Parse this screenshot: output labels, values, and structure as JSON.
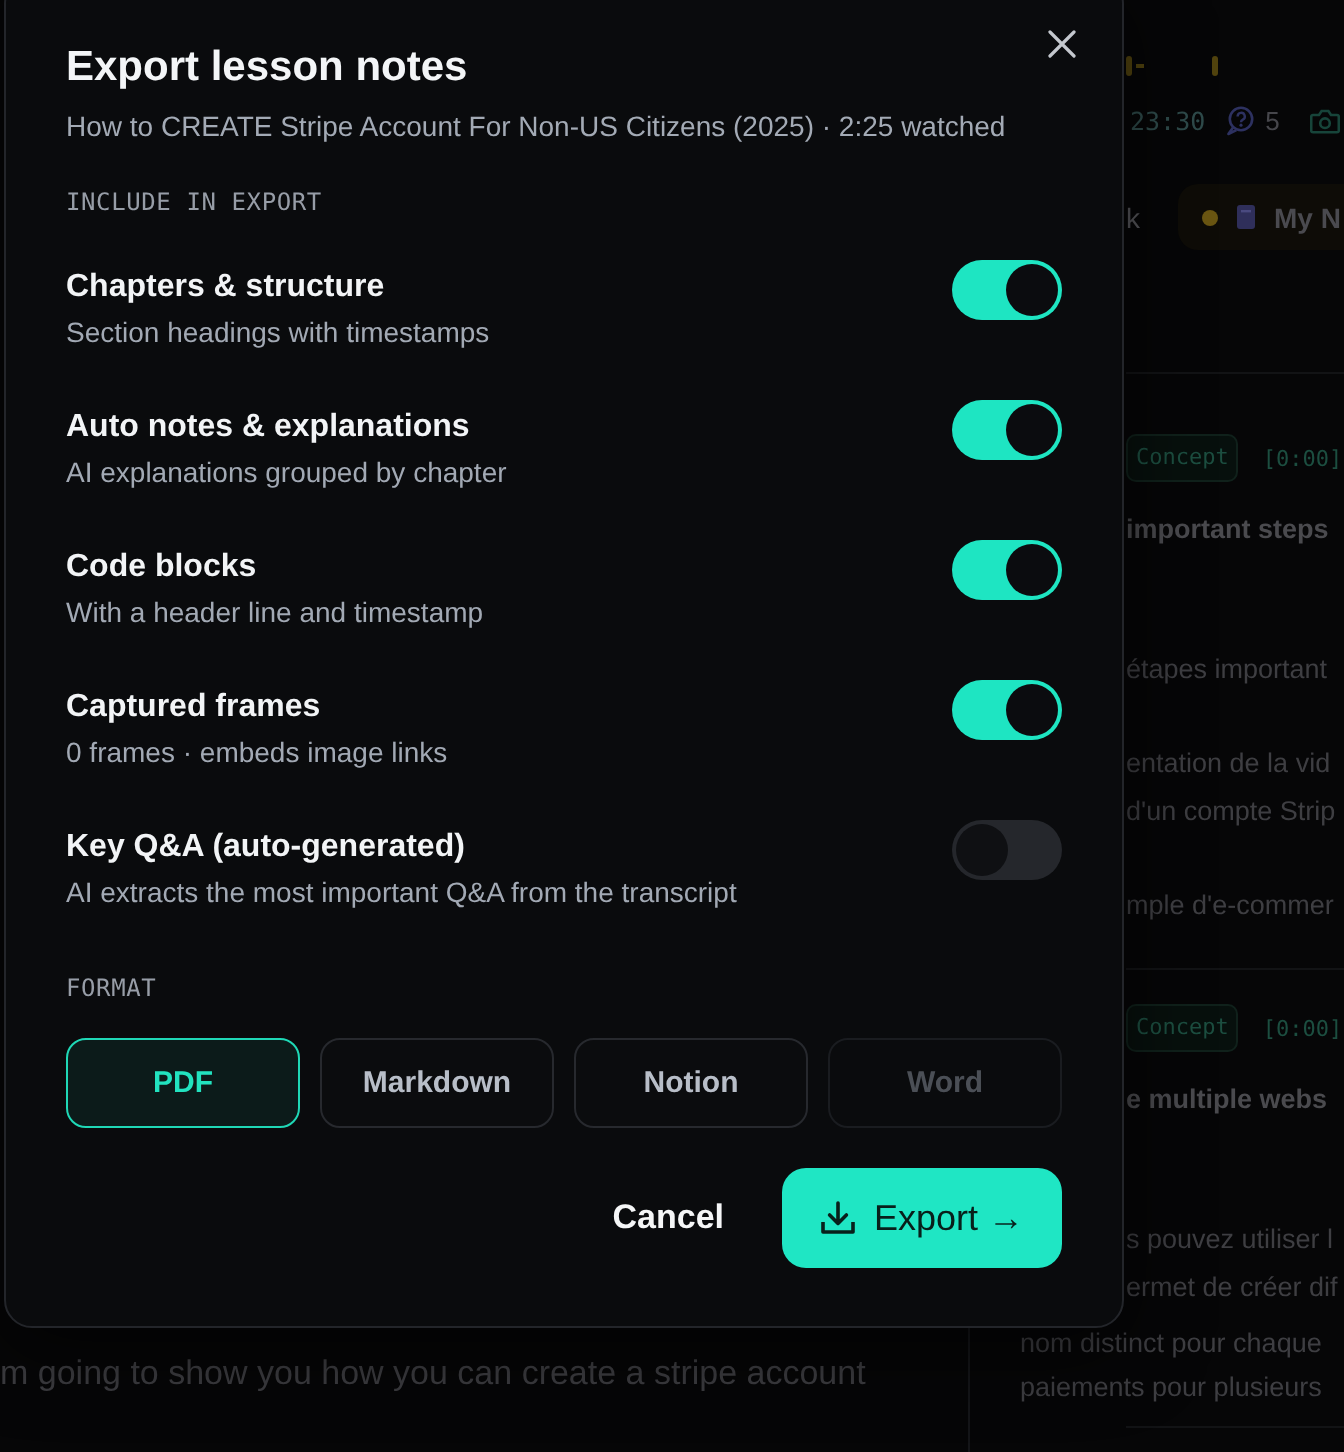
{
  "dialog": {
    "title": "Export lesson notes",
    "subtitle": "How to CREATE Stripe Account For Non-US Citizens (2025) · 2:25 watched",
    "include_label": "INCLUDE IN EXPORT",
    "options": [
      {
        "title": "Chapters & structure",
        "description": "Section headings with timestamps",
        "on": true
      },
      {
        "title": "Auto notes & explanations",
        "description": "AI explanations grouped by chapter",
        "on": true
      },
      {
        "title": "Code blocks",
        "description": "With a header line and timestamp",
        "on": true
      },
      {
        "title": "Captured frames",
        "description": "0 frames · embeds image links",
        "on": true
      },
      {
        "title": "Key Q&A (auto-generated)",
        "description": "AI extracts the most important Q&A from the transcript",
        "on": false
      }
    ],
    "format_label": "FORMAT",
    "formats": [
      {
        "label": "PDF",
        "selected": true,
        "disabled": false
      },
      {
        "label": "Markdown",
        "selected": false,
        "disabled": false
      },
      {
        "label": "Notion",
        "selected": false,
        "disabled": false
      },
      {
        "label": "Word",
        "selected": false,
        "disabled": true
      }
    ],
    "cancel_label": "Cancel",
    "export_label": "Export →"
  },
  "background": {
    "transcript_line": "m going to show you how you can create a stripe account",
    "player": {
      "time": "23:30",
      "question_count": "5"
    },
    "notes_tabs": [
      {
        "label": "k",
        "kind": "plain",
        "selected": false
      },
      {
        "label": "My N",
        "kind": "notebook",
        "selected": true
      }
    ],
    "notes": [
      {
        "tag": "Concept",
        "timestamp": "[0:00]",
        "heading": "important steps",
        "paragraphs": [
          [
            "étapes important"
          ],
          [
            "entation de la vid",
            "d'un compte Strip"
          ],
          [
            "mple d'e-commer"
          ]
        ]
      },
      {
        "tag": "Concept",
        "timestamp": "[0:00]",
        "heading": "e multiple webs",
        "paragraphs": [
          [
            "s pouvez utiliser l",
            "ermet de créer dif",
            "nom distinct pour chaque",
            "paiements pour plusieurs"
          ]
        ]
      }
    ]
  }
}
